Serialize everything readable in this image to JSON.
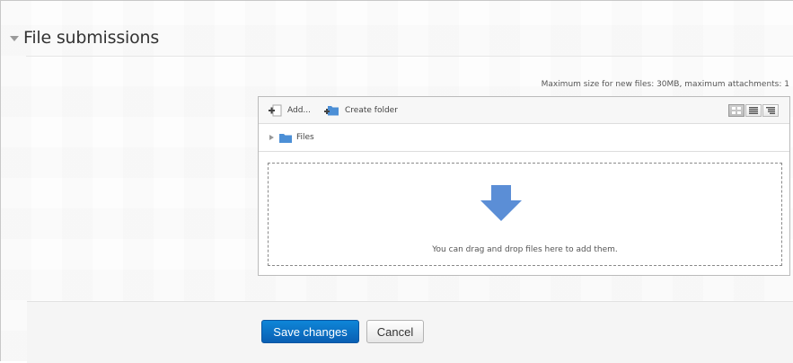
{
  "section": {
    "title": "File submissions"
  },
  "limits": {
    "text": "Maximum size for new files: 30MB, maximum attachments: 1"
  },
  "filemanager": {
    "toolbar": {
      "add_label": "Add...",
      "create_folder_label": "Create folder",
      "view_modes": [
        "icons-view-icon",
        "list-view-icon",
        "tree-view-icon"
      ],
      "active_view": "icons-view-icon"
    },
    "path": {
      "folder_label": "Files"
    },
    "dropzone": {
      "message": "You can drag and drop files here to add them."
    }
  },
  "actions": {
    "save_label": "Save changes",
    "cancel_label": "Cancel"
  },
  "colors": {
    "primary_button": "#0a6fc6",
    "folder_blue": "#4c8fd6",
    "drop_arrow": "#5b8ed6"
  }
}
